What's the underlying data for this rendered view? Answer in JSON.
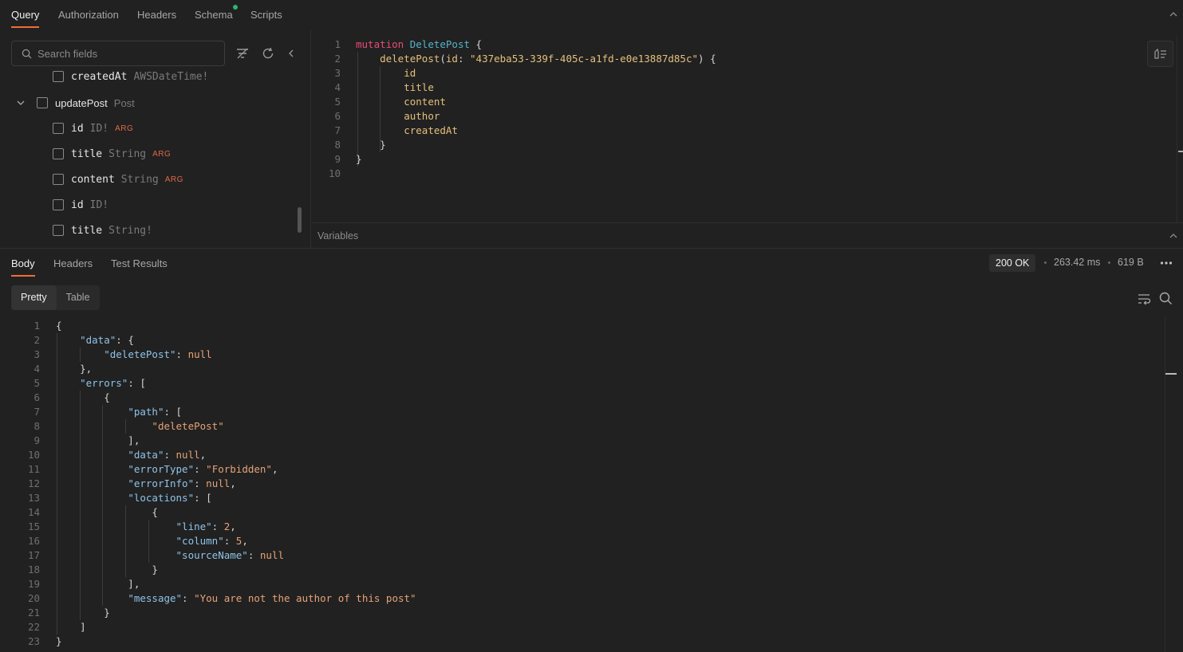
{
  "top_tabs": [
    {
      "label": "Query",
      "active": true
    },
    {
      "label": "Authorization",
      "active": false
    },
    {
      "label": "Headers",
      "active": false
    },
    {
      "label": "Schema",
      "active": false,
      "dot_color": "#2bb673"
    },
    {
      "label": "Scripts",
      "active": false
    }
  ],
  "schema": {
    "search_placeholder": "Search fields",
    "rows": [
      {
        "name": "createdAt",
        "type": "AWSDateTime!",
        "arg": ""
      },
      {
        "name": "updatePost",
        "type": "Post",
        "arg": "",
        "expanded": true
      },
      {
        "name": "id",
        "type": "ID!",
        "arg": "ARG"
      },
      {
        "name": "title",
        "type": "String",
        "arg": "ARG"
      },
      {
        "name": "content",
        "type": "String",
        "arg": "ARG"
      },
      {
        "name": "id",
        "type": "ID!",
        "arg": ""
      },
      {
        "name": "title",
        "type": "String!",
        "arg": ""
      }
    ]
  },
  "editor": {
    "line_numbers": [
      "1",
      "2",
      "3",
      "4",
      "5",
      "6",
      "7",
      "8",
      "9",
      "10"
    ],
    "mutation_kw": "mutation",
    "op_name": "DeletePost",
    "call_name": "deletePost",
    "arg_name": "id",
    "arg_value": "\"437eba53-339f-405c-a1fd-e0e13887d85c\"",
    "fields": [
      "id",
      "title",
      "content",
      "author",
      "createdAt"
    ]
  },
  "variables_label": "Variables",
  "response": {
    "tabs": [
      {
        "label": "Body",
        "active": true
      },
      {
        "label": "Headers",
        "active": false
      },
      {
        "label": "Test Results",
        "active": false
      }
    ],
    "status": "200 OK",
    "time": "263.42 ms",
    "size": "619 B",
    "view_modes": [
      {
        "label": "Pretty",
        "active": true
      },
      {
        "label": "Table",
        "active": false
      }
    ],
    "line_numbers": [
      "1",
      "2",
      "3",
      "4",
      "5",
      "6",
      "7",
      "8",
      "9",
      "10",
      "11",
      "12",
      "13",
      "14",
      "15",
      "16",
      "17",
      "18",
      "19",
      "20",
      "21",
      "22",
      "23"
    ],
    "json": {
      "k_data": "\"data\"",
      "k_deletePost": "\"deletePost\"",
      "null": "null",
      "k_errors": "\"errors\"",
      "k_path": "\"path\"",
      "v_path0": "\"deletePost\"",
      "k_errorType": "\"errorType\"",
      "v_errorType": "\"Forbidden\"",
      "k_errorInfo": "\"errorInfo\"",
      "k_locations": "\"locations\"",
      "k_line": "\"line\"",
      "v_line": "2",
      "k_column": "\"column\"",
      "v_column": "5",
      "k_sourceName": "\"sourceName\"",
      "k_message": "\"message\"",
      "v_message": "\"You are not the author of this post\""
    }
  }
}
